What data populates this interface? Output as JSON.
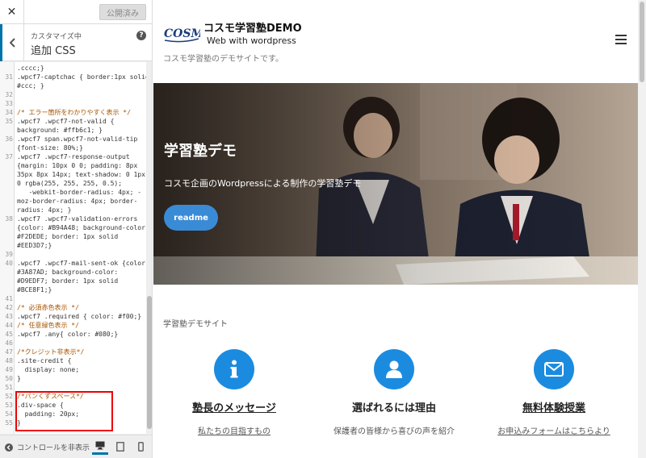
{
  "panel": {
    "publish_label": "公開済み",
    "breadcrumb": "カスタマイズ中",
    "section_title": "追加 CSS",
    "help": "?",
    "code_lines": [
      {
        "n": "",
        "t": ".cccc;}"
      },
      {
        "n": "31",
        "t": ".wpcf7-captchac { border:1px solid"
      },
      {
        "n": "",
        "t": "#ccc; }"
      },
      {
        "n": "32",
        "t": ""
      },
      {
        "n": "33",
        "t": ""
      },
      {
        "n": "34",
        "t": "/* エラー箇所をわかりやすく表示 */"
      },
      {
        "n": "35",
        "t": ".wpcf7 .wpcf7-not-valid {"
      },
      {
        "n": "",
        "t": "background: #ffb6c1; }"
      },
      {
        "n": "36",
        "t": ".wpcf7 span.wpcf7-not-valid-tip"
      },
      {
        "n": "",
        "t": "{font-size: 80%;}"
      },
      {
        "n": "37",
        "t": ".wpcf7 .wpcf7-response-output"
      },
      {
        "n": "",
        "t": "{margin: 10px 0 0; padding: 8px"
      },
      {
        "n": "",
        "t": "35px 8px 14px; text-shadow: 0 1px"
      },
      {
        "n": "",
        "t": "0 rgba(255, 255, 255, 0.5);"
      },
      {
        "n": "",
        "t": "   -webkit-border-radius: 4px; -"
      },
      {
        "n": "",
        "t": "moz-border-radius: 4px; border-"
      },
      {
        "n": "",
        "t": "radius: 4px; }"
      },
      {
        "n": "38",
        "t": ".wpcf7 .wpcf7-validation-errors"
      },
      {
        "n": "",
        "t": "{color: #B94A48; background-color:"
      },
      {
        "n": "",
        "t": "#F2DEDE; border: 1px solid"
      },
      {
        "n": "",
        "t": "#EED3D7;}"
      },
      {
        "n": "39",
        "t": ""
      },
      {
        "n": "40",
        "t": ".wpcf7 .wpcf7-mail-sent-ok {color:"
      },
      {
        "n": "",
        "t": "#3A87AD; background-color:"
      },
      {
        "n": "",
        "t": "#D9EDF7; border: 1px solid"
      },
      {
        "n": "",
        "t": "#BCE8F1;}"
      },
      {
        "n": "41",
        "t": ""
      },
      {
        "n": "42",
        "t": "/* 必須赤色表示 */"
      },
      {
        "n": "43",
        "t": ".wpcf7 .required { color: #f00;}"
      },
      {
        "n": "44",
        "t": "/* 任意緑色表示 */"
      },
      {
        "n": "45",
        "t": ".wpcf7 .any{ color: #080;}"
      },
      {
        "n": "46",
        "t": ""
      },
      {
        "n": "47",
        "t": "/*クレジット非表示*/"
      },
      {
        "n": "48",
        "t": ".site-credit {"
      },
      {
        "n": "49",
        "t": "  display: none;"
      },
      {
        "n": "50",
        "t": "}"
      },
      {
        "n": "51",
        "t": ""
      },
      {
        "n": "52",
        "t": "/*パンくずスペース*/"
      },
      {
        "n": "53",
        "t": ".div-space {"
      },
      {
        "n": "54",
        "t": "  padding: 20px;"
      },
      {
        "n": "55",
        "t": "}"
      }
    ],
    "hide_controls_label": "コントロールを非表示"
  },
  "site": {
    "logo_text": "COSMO",
    "name": "コスモ学習塾DEMO",
    "sub": "Web with wordpress",
    "desc": "コスモ学習塾のデモサイトです。"
  },
  "hero": {
    "title": "学習塾デモ",
    "text": "コスモ企画のWordpressによる制作の学習塾デモ",
    "button": "readme"
  },
  "features": {
    "heading": "学習塾デモサイト",
    "items": [
      {
        "icon": "info-icon",
        "title": "塾長のメッセージ",
        "sub": "私たちの目指すもの"
      },
      {
        "icon": "user-icon",
        "title": "選ばれるには理由",
        "sub": "保護者の皆様から喜びの声を紹介"
      },
      {
        "icon": "mail-icon",
        "title": "無料体験授業",
        "sub": "お申込みフォームはこちらより"
      }
    ]
  },
  "colors": {
    "accent": "#1b8be0",
    "wp_blue": "#0073aa",
    "highlight": "#e00000"
  }
}
